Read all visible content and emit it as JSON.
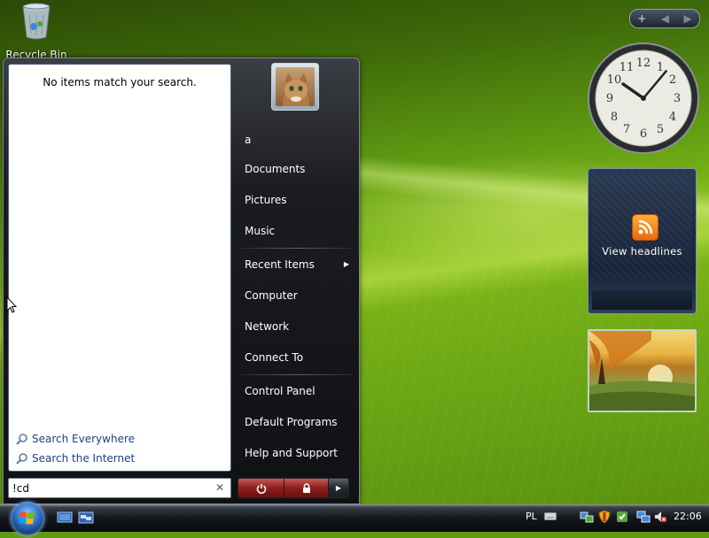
{
  "desktop": {
    "icons": [
      {
        "label": "Recycle Bin",
        "icon": "recycle-bin-icon"
      }
    ]
  },
  "sidebar": {
    "toolbar": {
      "add_label": "+",
      "prev_label": "◀",
      "next_label": "▶"
    },
    "clock": {
      "time": "10:10",
      "hour_hand_deg": 305,
      "minute_hand_deg": 40
    },
    "feed": {
      "label": "View headlines",
      "icon": "rss-icon"
    },
    "slideshow": {
      "icon": "landscape-photo"
    }
  },
  "start_menu": {
    "search_results": {
      "message": "No items match your search."
    },
    "search_links": [
      {
        "label": "Search Everywhere",
        "icon": "search-icon"
      },
      {
        "label": "Search the Internet",
        "icon": "search-icon"
      }
    ],
    "search": {
      "value": "!cd",
      "clear_label": "✕"
    },
    "user": {
      "name": "a",
      "picture": "cat-avatar"
    },
    "right_items": {
      "documents": "Documents",
      "pictures": "Pictures",
      "music": "Music",
      "recent_items": "Recent Items",
      "computer": "Computer",
      "network": "Network",
      "connect_to": "Connect To",
      "control_panel": "Control Panel",
      "default_programs": "Default Programs",
      "help_support": "Help and Support"
    },
    "power": {
      "power_icon": "power-icon",
      "lock_icon": "lock-icon",
      "options_arrow": "▶"
    }
  },
  "taskbar": {
    "language": "PL",
    "clock": "22:06",
    "colors": {
      "start_orb": "#2a6cc4",
      "power_button": "#8c1f1b"
    }
  }
}
